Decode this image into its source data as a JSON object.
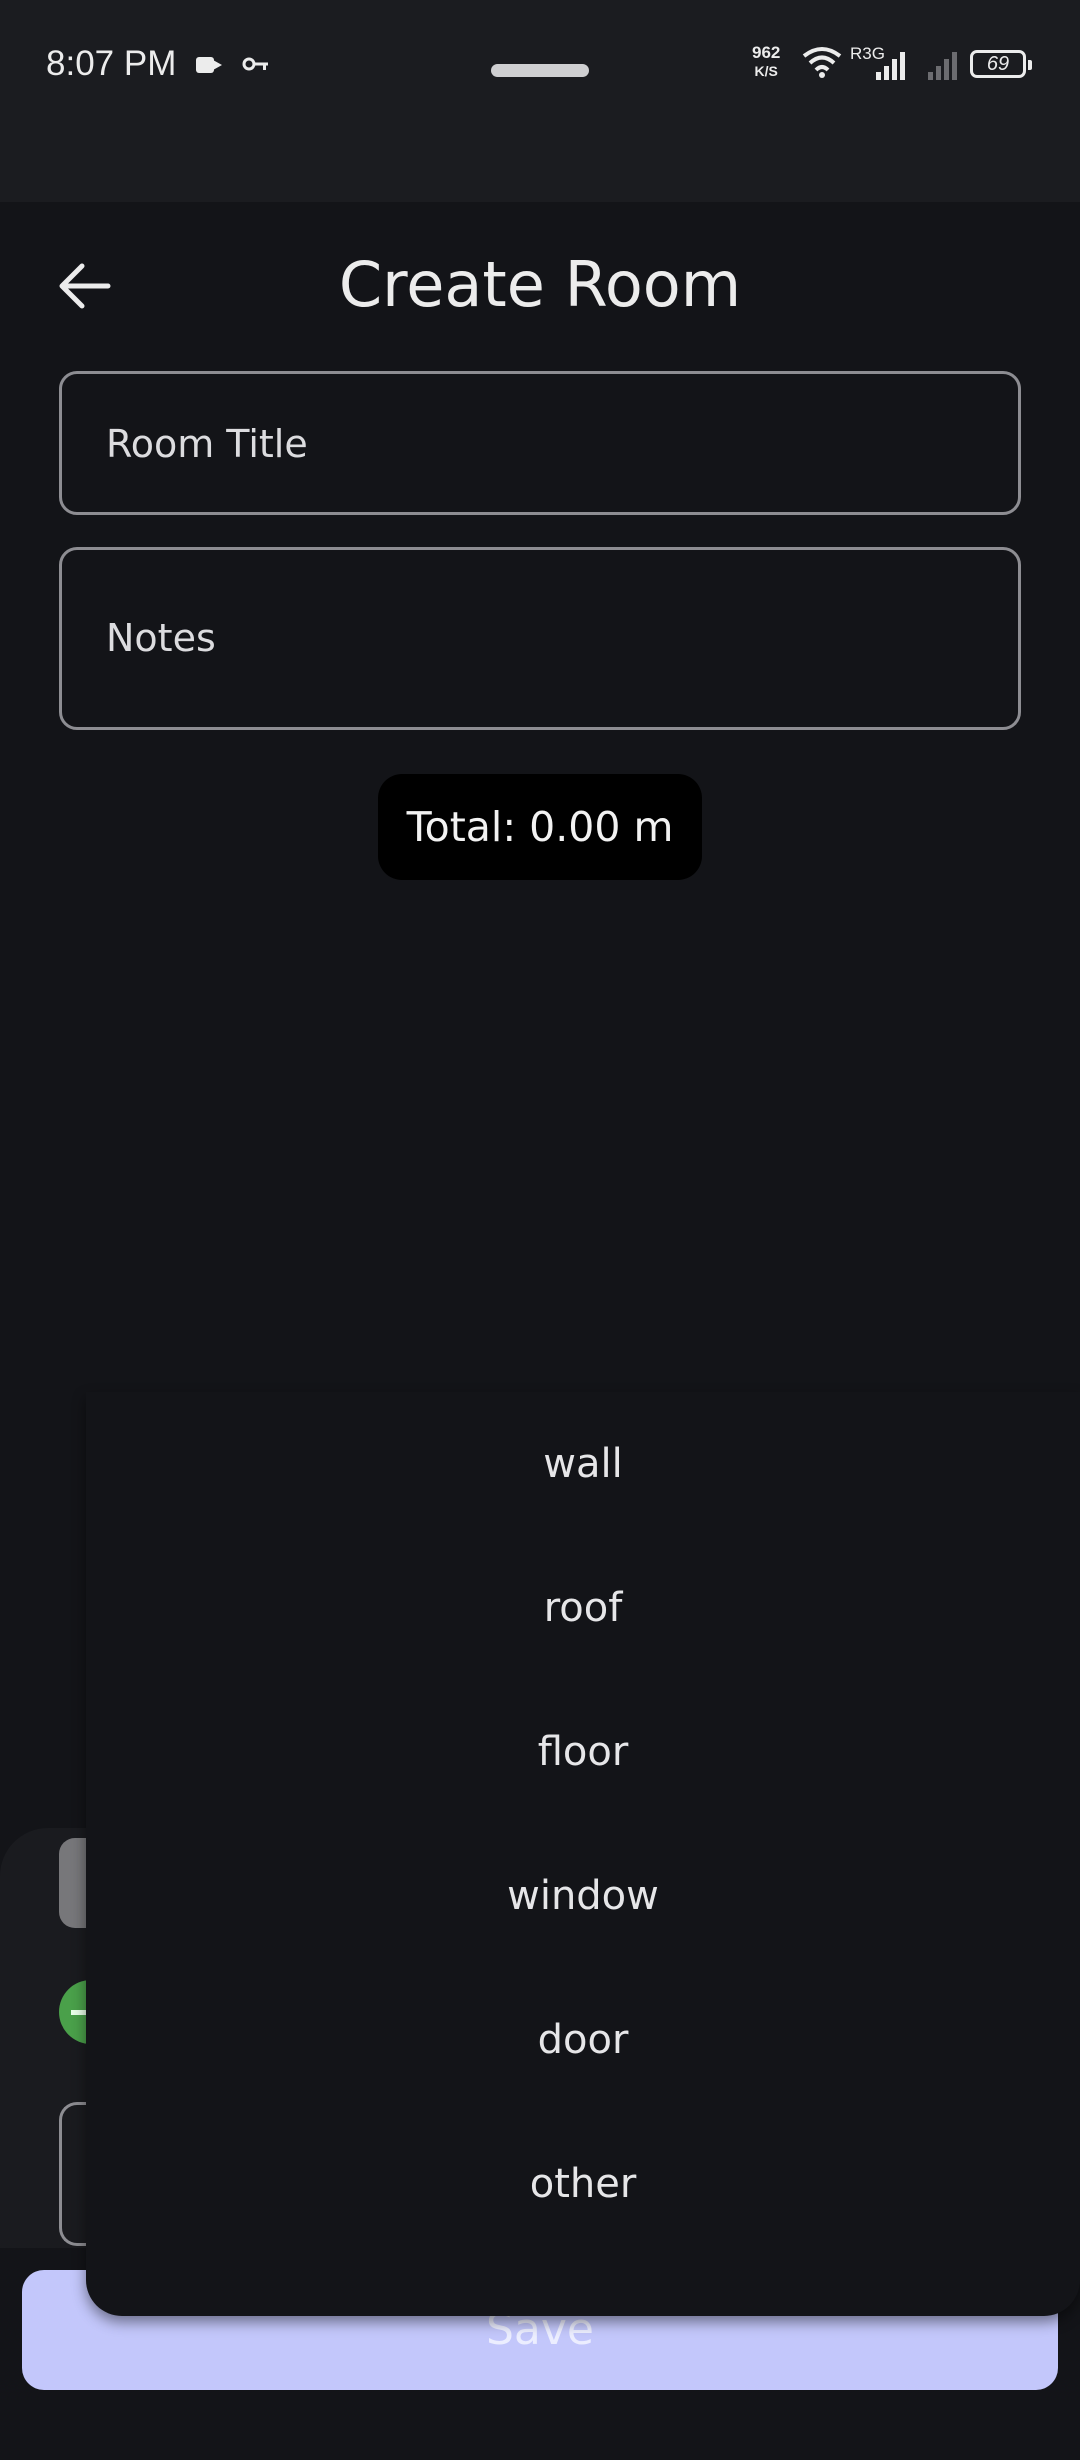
{
  "status_bar": {
    "time": "8:07 PM",
    "net_speed": "962",
    "net_unit": "K/S",
    "network_label": "R3G",
    "battery": "69",
    "icons": [
      "video-camera-icon",
      "vpn-key-icon",
      "wifi-icon",
      "signal-icon",
      "signal-icon",
      "battery-icon"
    ]
  },
  "header": {
    "title": "Create Room",
    "back_icon": "back-arrow-icon"
  },
  "form": {
    "room_title_placeholder": "Room Title",
    "notes_placeholder": "Notes"
  },
  "total": "Total: 0.00 m",
  "dropdown": {
    "options": [
      "wall",
      "roof",
      "floor",
      "window",
      "door",
      "other"
    ]
  },
  "save_label": "Save",
  "colors": {
    "background": "#131418",
    "status_bar": "#1b1c20",
    "save_button": "#c3c7fb",
    "add_button": "#4aa04a"
  }
}
